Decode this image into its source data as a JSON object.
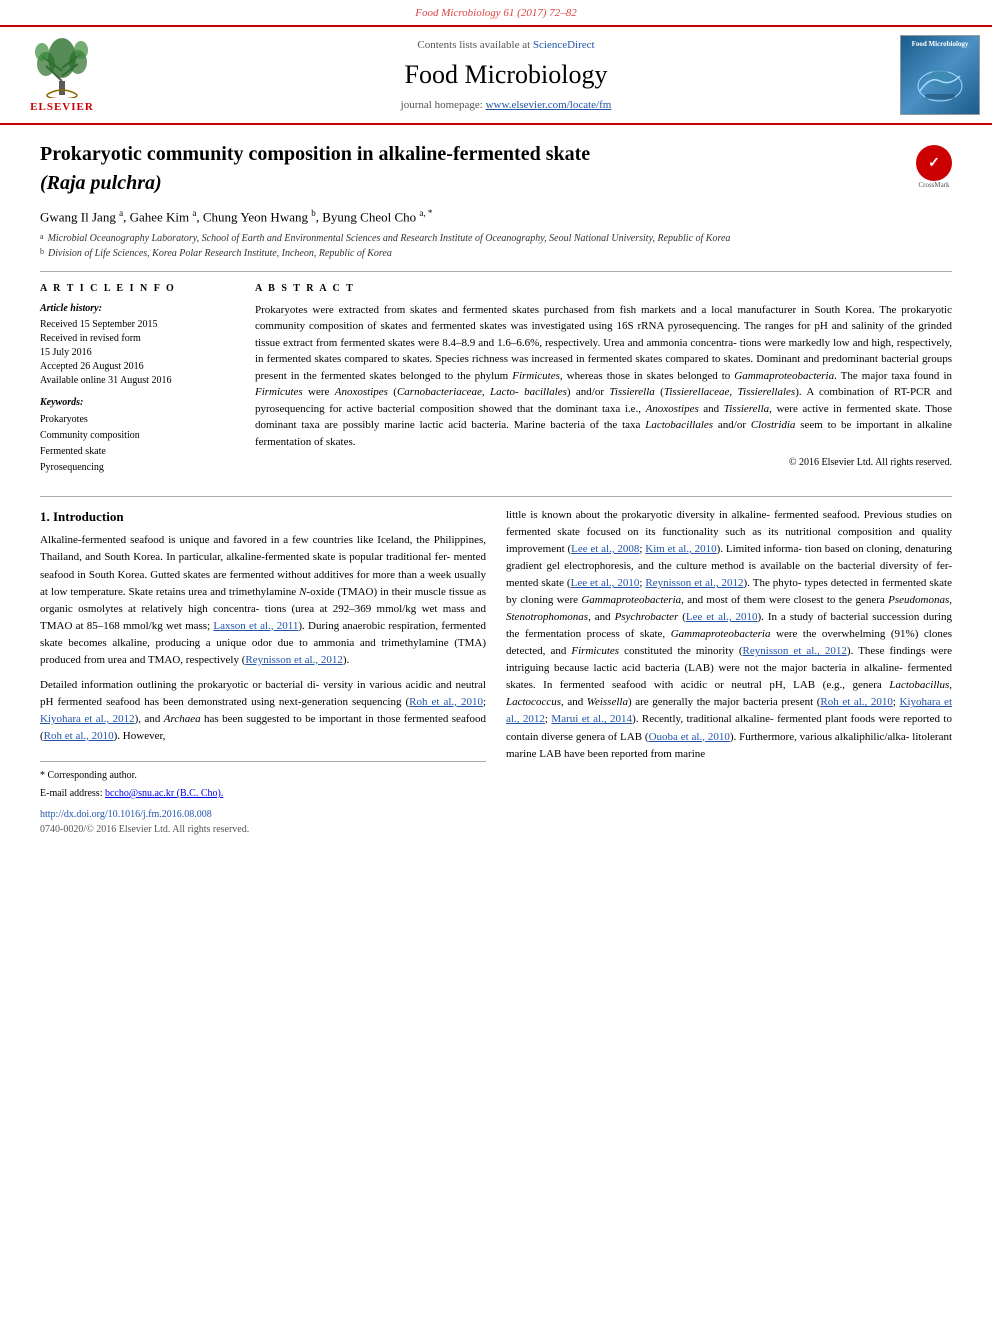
{
  "journal_ref": "Food Microbiology 61 (2017) 72–82",
  "header": {
    "sciencedirect_text": "Contents lists available at",
    "sciencedirect_link": "ScienceDirect",
    "journal_title": "Food Microbiology",
    "homepage_text": "journal homepage:",
    "homepage_link": "www.elsevier.com/locate/fm",
    "elsevier_brand": "ELSEVIER",
    "cover_label": "Food Microbiology"
  },
  "article": {
    "title_line1": "Prokaryotic community composition in alkaline-fermented skate",
    "title_line2": "(Raja pulchra)",
    "authors": "Gwang Il Jang a, Gahee Kim a, Chung Yeon Hwang b, Byung Cheol Cho a, *",
    "affil_a": "Microbial Oceanography Laboratory, School of Earth and Environmental Sciences and Research Institute of Oceanography, Seoul National University, Republic of Korea",
    "affil_b": "Division of Life Sciences, Korea Polar Research Institute, Incheon, Republic of Korea"
  },
  "article_info": {
    "section_label": "A R T I C L E   I N F O",
    "history_title": "Article history:",
    "received": "Received 15 September 2015",
    "revised": "Received in revised form",
    "revised2": "15 July 2016",
    "accepted": "Accepted 26 August 2016",
    "available": "Available online 31 August 2016",
    "keywords_title": "Keywords:",
    "keywords": [
      "Prokaryotes",
      "Community composition",
      "Fermented skate",
      "Pyrosequencing"
    ]
  },
  "abstract": {
    "section_label": "A B S T R A C T",
    "text": "Prokaryotes were extracted from skates and fermented skates purchased from fish markets and a local manufacturer in South Korea. The prokaryotic community composition of skates and fermented skates was investigated using 16S rRNA pyrosequencing. The ranges for pH and salinity of the grinded tissue extract from fermented skates were 8.4–8.9 and 1.6–6.6%, respectively. Urea and ammonia concentrations were markedly low and high, respectively, in fermented skates compared to skates. Species richness was increased in fermented skates compared to skates. Dominant and predominant bacterial groups present in the fermented skates belonged to the phylum Firmicutes, whereas those in skates belonged to Gammaproteobacteria. The major taxa found in Firmicutes were Anoxostipes (Carnobacteriaceae, Lactobacillales) and/or Tissierella (Tissierellaceae, Tissierellales). A combination of RT-PCR and pyrosequencing for active bacterial composition showed that the dominant taxa i.e., Anoxostipes and Tissierella, were active in fermented skate. Those dominant taxa are possibly marine lactic acid bacteria. Marine bacteria of the taxa Lactobacillales and/or Clostridia seem to be important in alkaline fermentation of skates.",
    "copyright": "© 2016 Elsevier Ltd. All rights reserved."
  },
  "body": {
    "section1_heading": "1. Introduction",
    "col_left_paragraphs": [
      "Alkaline-fermented seafood is unique and favored in a few countries like Iceland, the Philippines, Thailand, and South Korea. In particular, alkaline-fermented skate is popular traditional fermented seafood in South Korea. Gutted skates are fermented without additives for more than a week usually at low temperature. Skate retains urea and trimethylamine N-oxide (TMAO) in their muscle tissue as organic osmolytes at relatively high concentrations (urea at 292–369 mmol/kg wet mass and TMAO at 85–168 mmol/kg wet mass; Laxson et al., 2011). During anaerobic respiration, fermented skate becomes alkaline, producing a unique odor due to ammonia and trimethylamine (TMA) produced from urea and TMAO, respectively (Reynisson et al., 2012).",
      "Detailed information outlining the prokaryotic or bacterial diversity in various acidic and neutral pH fermented seafood has been demonstrated using next-generation sequencing (Roh et al., 2010; Kiyohara et al., 2012), and Archaea has been suggested to be important in those fermented seafood (Roh et al., 2010). However,"
    ],
    "col_right_paragraphs": [
      "little is known about the prokaryotic diversity in alkaline-fermented seafood. Previous studies on fermented skate focused on its functionality such as its nutritional composition and quality improvement (Lee et al., 2008; Kim et al., 2010). Limited information based on cloning, denaturing gradient gel electrophoresis, and the culture method is available on the bacterial diversity of fermented skate (Lee et al., 2010; Reynisson et al., 2012). The phylotypes detected in fermented skate by cloning were Gammaproteobacteria, and most of them were closest to the genera Pseudomonas, Stenotrophomonas, and Psychrobacter (Lee et al., 2010). In a study of bacterial succession during the fermentation process of skate, Gammaproteobacteria were the overwhelming (91%) clones detected, and Firmicutes constituted the minority (Reynisson et al., 2012). These findings were intriguing because lactic acid bacteria (LAB) were not the major bacteria in alkaline-fermented skates. In fermented seafood with acidic or neutral pH, LAB (e.g., genera Lactobacillus, Lactococcus, and Weissella) are generally the major bacteria present (Roh et al., 2010; Kiyohara et al., 2012; Marui et al., 2014). Recently, traditional alkaline-fermented plant foods were reported to contain diverse genera of LAB (Ouoba et al., 2010). Furthermore, various alkaliphilic/alkalitolerant marine LAB have been reported from marine"
    ]
  },
  "footnotes": {
    "corresponding_label": "* Corresponding author.",
    "email_label": "E-mail address:",
    "email": "bccho@snu.ac.kr (B.C. Cho).",
    "doi": "http://dx.doi.org/10.1016/j.fm.2016.08.008",
    "issn": "0740-0020/© 2016 Elsevier Ltd. All rights reserved."
  }
}
